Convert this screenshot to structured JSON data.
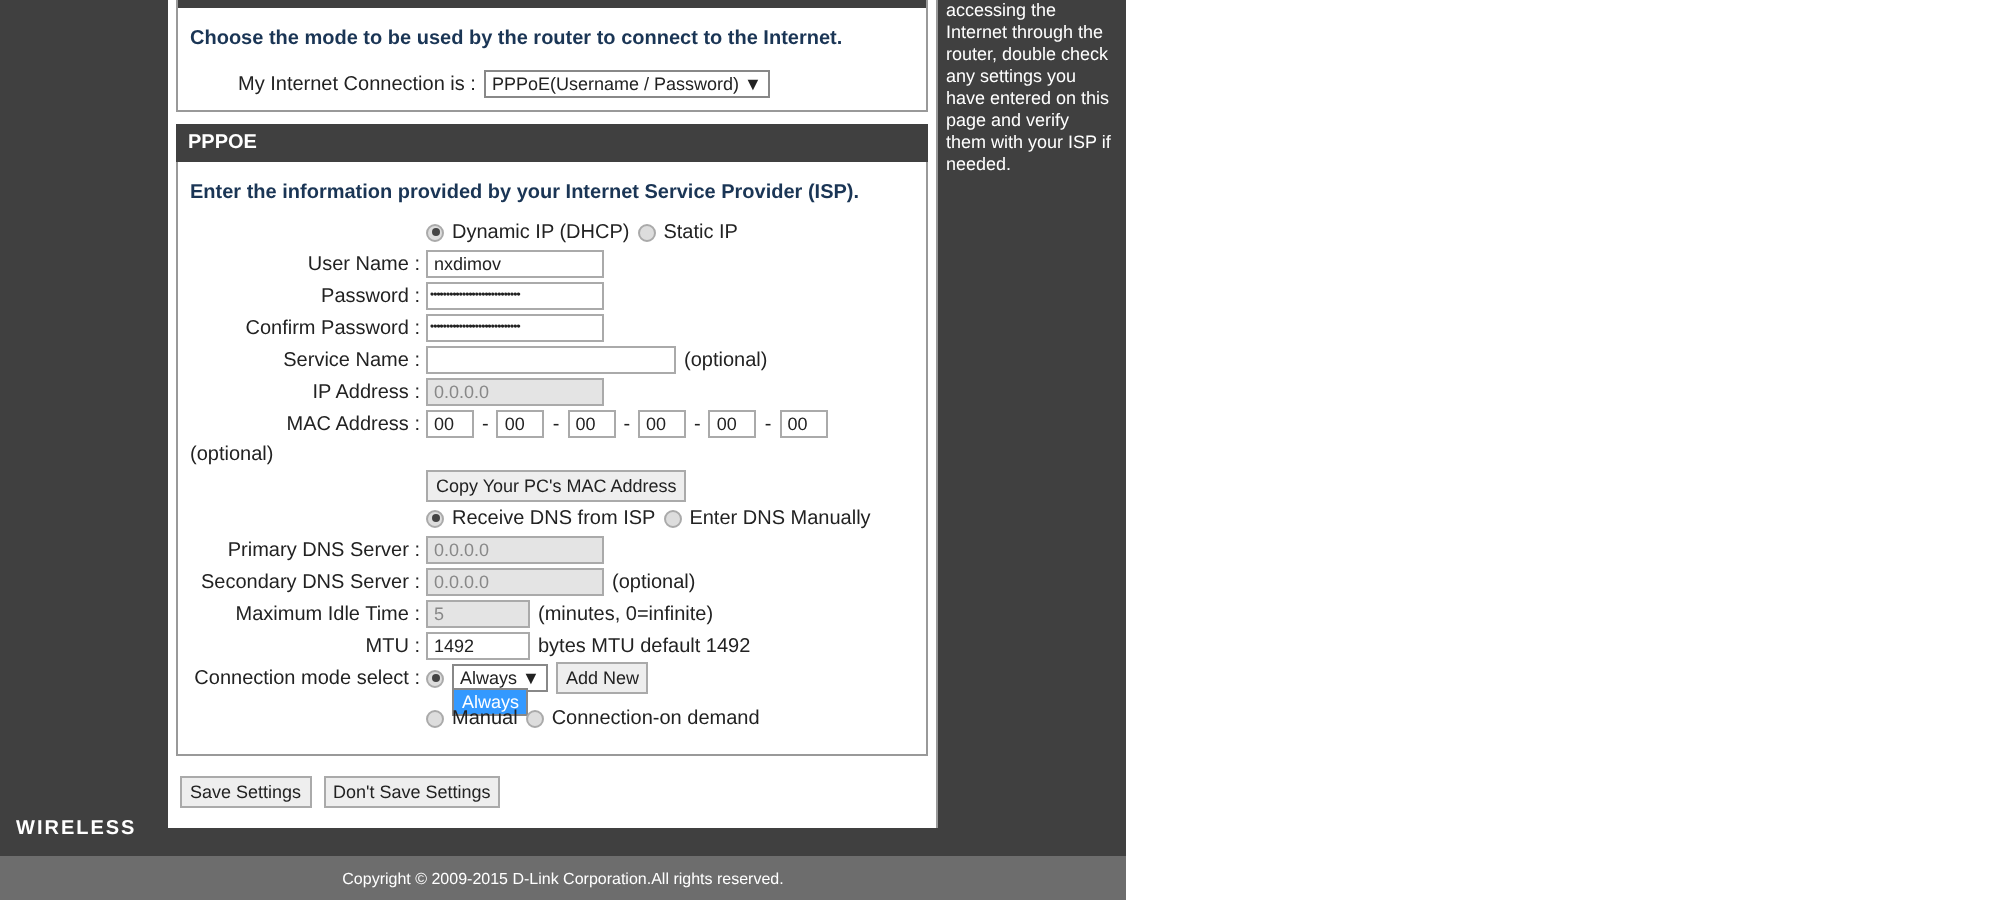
{
  "help_text": "accessing the Internet through the router, double check any settings you have entered on this page and verify them with your ISP if needed.",
  "mode_section": {
    "intro": "Choose the mode to be used by the router to connect to the Internet.",
    "connection_label": "My Internet Connection is :",
    "connection_value": "PPPoE(Username / Password)",
    "arrow": "▼"
  },
  "pppoe_section": {
    "title": "PPPOE",
    "intro": "Enter the information provided by your Internet Service Provider (ISP).",
    "rows": [
      {
        "kind": "radios",
        "options": [
          {
            "label": "Dynamic IP (DHCP)",
            "selected": true
          },
          {
            "label": "Static IP",
            "selected": false
          }
        ]
      },
      {
        "kind": "field",
        "label": "User Name :",
        "value": "nxdimov",
        "disabled": false
      },
      {
        "kind": "password",
        "label": "Password :",
        "value": "••••••••••••••••••••••••••••",
        "disabled": false
      },
      {
        "kind": "password",
        "label": "Confirm Password :",
        "value": "••••••••••••••••••••••••••••",
        "disabled": false
      },
      {
        "kind": "wide_field",
        "label": "Service Name :",
        "disabled": false,
        "suffix": "(optional)"
      },
      {
        "kind": "field",
        "label": "IP Address :",
        "value": "0.0.0.0",
        "disabled": true
      },
      {
        "kind": "mac",
        "label": "MAC Address :",
        "parts": [
          {
            "value": "00"
          },
          {
            "separator": "-",
            "value": "00"
          },
          {
            "separator": "-",
            "value": "00"
          },
          {
            "separator": "-",
            "value": "00"
          },
          {
            "separator": "-",
            "value": "00"
          },
          {
            "separator": "-",
            "value": "00"
          }
        ],
        "note": "(optional)"
      },
      {
        "kind": "button",
        "label": "Copy Your PC's MAC Address"
      },
      {
        "kind": "radios",
        "options": [
          {
            "label": "Receive DNS from ISP",
            "selected": true
          },
          {
            "label": "Enter DNS Manually",
            "selected": false
          }
        ]
      },
      {
        "kind": "field",
        "label": "Primary DNS Server :",
        "value": "0.0.0.0",
        "disabled": true
      },
      {
        "kind": "field",
        "label": "Secondary DNS Server :",
        "value": "0.0.0.0",
        "disabled": true,
        "suffix": "(optional)"
      },
      {
        "kind": "short_field",
        "label": "Maximum Idle Time :",
        "value": "5",
        "disabled": true,
        "suffix": "(minutes, 0=infinite)"
      },
      {
        "kind": "short_field",
        "label": "MTU :",
        "value": "1492",
        "disabled": false,
        "suffix": "bytes MTU default 1492"
      },
      {
        "kind": "connmode",
        "label": "Connection mode select :",
        "selected": true,
        "select_value": "Always",
        "arrow": "▼",
        "menu_option": "Always",
        "button": "Add New",
        "options": [
          {
            "label": "Manual",
            "selected": false
          },
          {
            "label": "Connection-on demand",
            "selected": false
          }
        ]
      }
    ]
  },
  "buttons": [
    "Save Settings",
    "Don't Save Settings"
  ],
  "footer": {
    "logo": "WIRELESS",
    "copyright": "Copyright © 2009-2015 D-Link Corporation.All rights reserved."
  }
}
